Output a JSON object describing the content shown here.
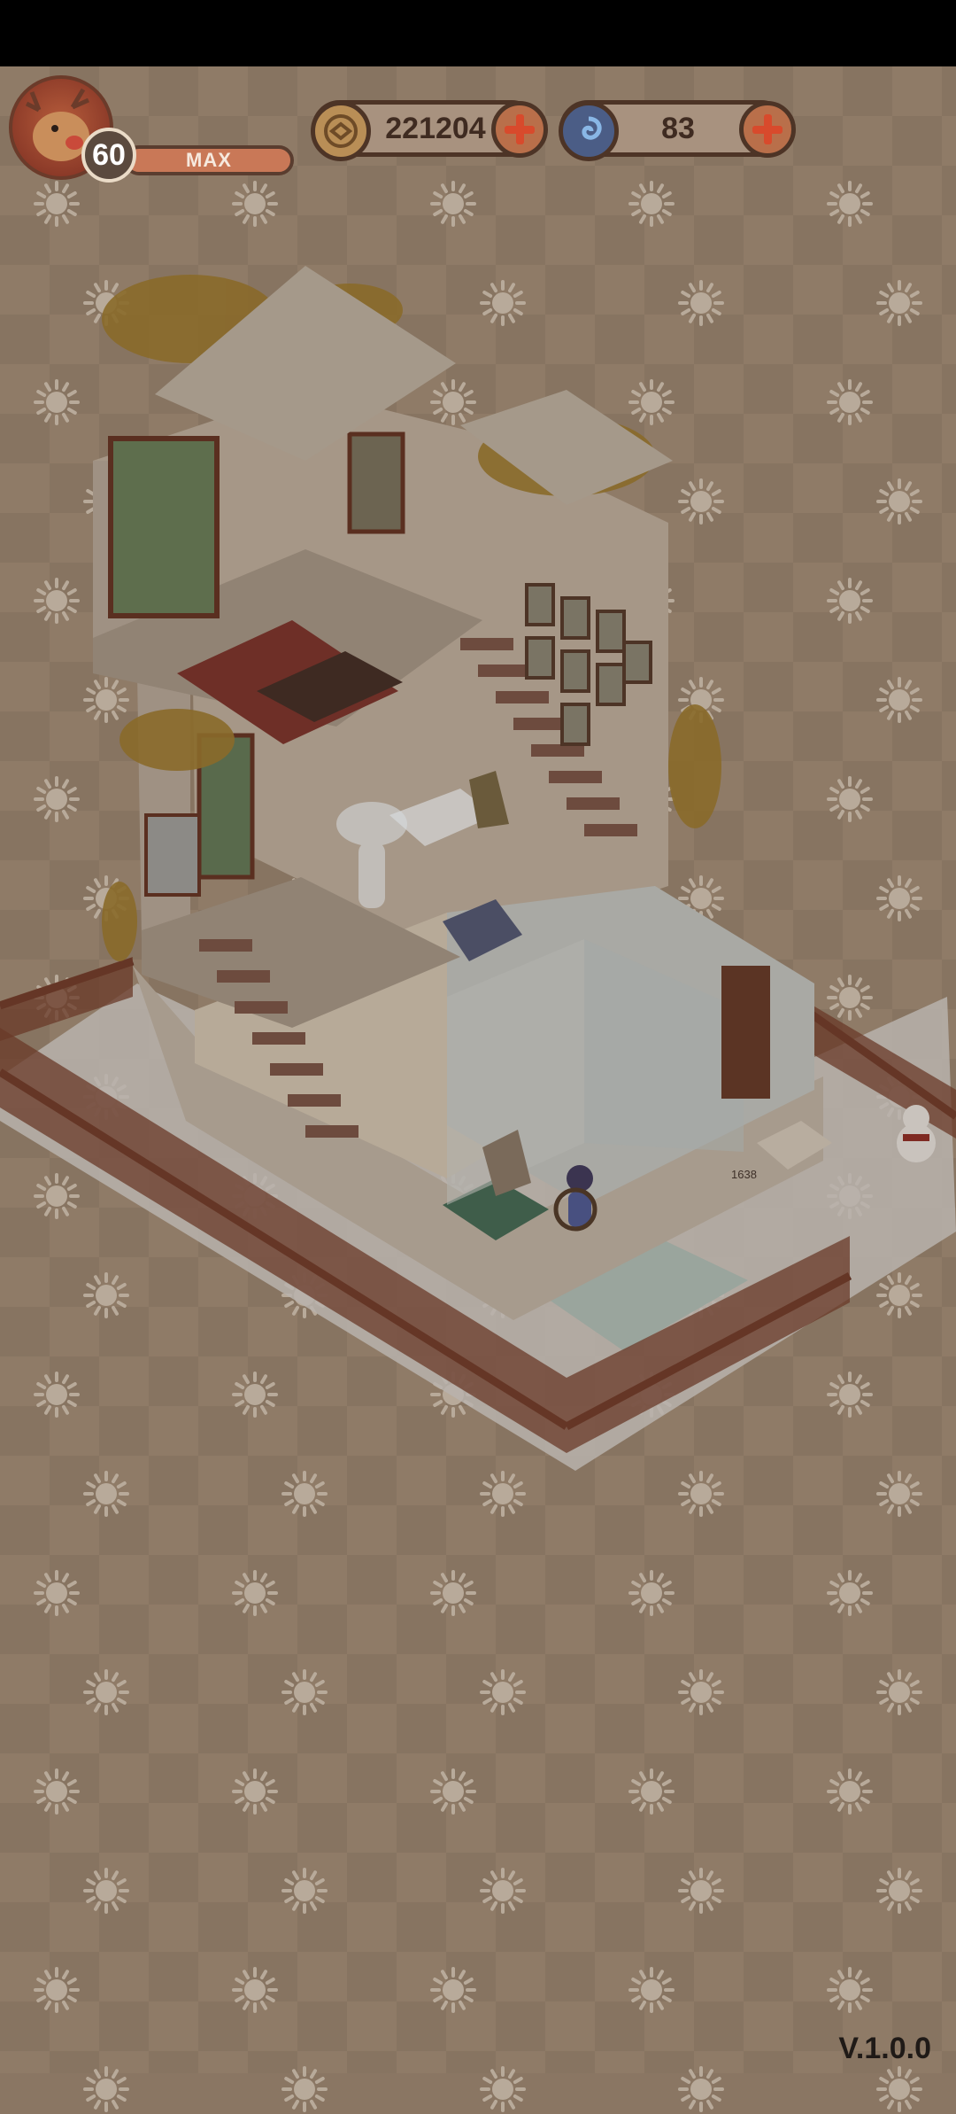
{
  "player": {
    "level": "60",
    "xp_label": "MAX",
    "avatar_icon": "reindeer-avatar-icon"
  },
  "currencies": [
    {
      "name": "coins",
      "value": "221204",
      "icon": "coin-icon"
    },
    {
      "name": "energy",
      "value": "83",
      "icon": "swirl-gem-icon"
    }
  ],
  "scene": {
    "plaque_number": "1638"
  },
  "version": "V.1.0.0",
  "colors": {
    "overlay_bg": "#8f7b67",
    "accent": "#d84a2c",
    "frame": "#4d3426"
  }
}
